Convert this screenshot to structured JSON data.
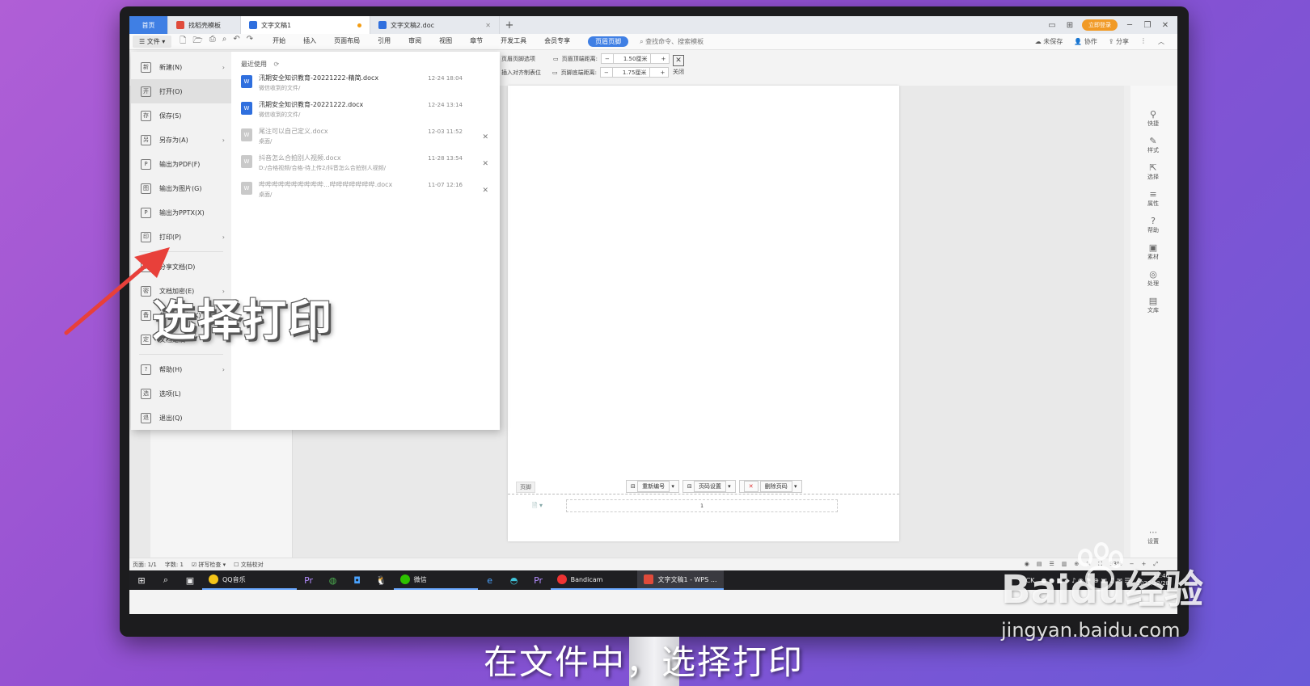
{
  "tabs": {
    "home": "首页",
    "template": "找稻壳模板",
    "doc1": "文字文稿1",
    "doc2": "文字文稿2.doc",
    "add": "+"
  },
  "titlebar": {
    "login": "立即登录"
  },
  "menu": {
    "file": "文件",
    "ribbon_tabs": [
      "开始",
      "插入",
      "页面布局",
      "引用",
      "审阅",
      "视图",
      "章节",
      "开发工具",
      "会员专享"
    ],
    "active_tab": "页眉页脚",
    "search_placeholder": "查找命令、搜索模板",
    "unsaved": "未保存",
    "collab": "协作",
    "share": "分享"
  },
  "hf_tools": {
    "options": "页眉页脚选项",
    "insert_align": "插入对齐制表位",
    "header_top_label": "页眉顶端距离:",
    "header_top_value": "1.50厘米",
    "footer_bottom_label": "页脚底端距离:",
    "footer_bottom_value": "1.75厘米",
    "minus": "−",
    "plus": "+",
    "close": "关闭"
  },
  "file_menu": {
    "items": [
      {
        "label": "新建(N)",
        "icon": "新",
        "arrow": true
      },
      {
        "label": "打开(O)",
        "icon": "开",
        "arrow": false
      },
      {
        "label": "保存(S)",
        "icon": "存",
        "arrow": false
      },
      {
        "label": "另存为(A)",
        "icon": "另",
        "arrow": true
      },
      {
        "label": "输出为PDF(F)",
        "icon": "P",
        "arrow": false
      },
      {
        "label": "输出为图片(G)",
        "icon": "图",
        "arrow": false
      },
      {
        "label": "输出为PPTX(X)",
        "icon": "P",
        "arrow": false
      },
      {
        "label": "打印(P)",
        "icon": "印",
        "arrow": true
      },
      {
        "label": "分享文档(D)",
        "icon": "享",
        "arrow": false
      },
      {
        "label": "文档加密(E)",
        "icon": "密",
        "arrow": true
      },
      {
        "label": "备份与恢复(K)",
        "icon": "备",
        "arrow": true
      },
      {
        "label": "文档定稿",
        "icon": "定",
        "arrow": false
      },
      {
        "label": "帮助(H)",
        "icon": "?",
        "arrow": true
      },
      {
        "label": "选项(L)",
        "icon": "选",
        "arrow": false
      },
      {
        "label": "退出(Q)",
        "icon": "退",
        "arrow": false
      }
    ],
    "recent_title": "最近使用",
    "recent": [
      {
        "name": "汛期安全知识教育-20221222-精简.docx",
        "path": "微信收到的文件/",
        "time": "12-24 18:04",
        "dim": false
      },
      {
        "name": "汛期安全知识教育-20221222.docx",
        "path": "微信收到的文件/",
        "time": "12-24 13:14",
        "dim": false
      },
      {
        "name": "尾注可以自己定义.docx",
        "path": "桌面/",
        "time": "12-03 11:52",
        "dim": true
      },
      {
        "name": "抖音怎么合拍别人视频.docx",
        "path": "D:/合格视频/合格-待上传2/抖音怎么合拍别人视频/",
        "time": "11-28 13:54",
        "dim": true
      },
      {
        "name": "哔哔哔哔哔哔哔哔哔哔...哔哔哔哔哔哔哔.docx",
        "path": "桌面/",
        "time": "11-07 12:16",
        "dim": true
      }
    ]
  },
  "document": {
    "footer_label": "页脚",
    "renumber": "重新编号",
    "page_setup": "页码设置",
    "delete_page": "删除页码",
    "page_number": "1"
  },
  "rightbar": {
    "items": [
      {
        "label": "快捷",
        "glyph": "⚲"
      },
      {
        "label": "样式",
        "glyph": "✎"
      },
      {
        "label": "选择",
        "glyph": "⇱"
      },
      {
        "label": "属性",
        "glyph": "≡"
      },
      {
        "label": "帮助",
        "glyph": "?"
      },
      {
        "label": "素材",
        "glyph": "▣"
      },
      {
        "label": "处理",
        "glyph": "◎"
      },
      {
        "label": "文库",
        "glyph": "▤"
      }
    ],
    "settings": "设置"
  },
  "statusbar": {
    "page": "页面: 1/1",
    "words": "字数: 1",
    "spell": "拼写检查",
    "proof": "文档校对",
    "zoom": "93%"
  },
  "taskbar": {
    "qqmusic": "QQ音乐",
    "wechat": "微信",
    "bandicam": "Bandicam",
    "wps": "文字文稿1 - WPS ...",
    "time": "11:46",
    "date": "2022/12/28",
    "ime": "CK"
  },
  "overlay": {
    "caption": "选择打印",
    "subtitle": "在文件中，选择打印",
    "watermark": "Baidu经验",
    "watermark_url": "jingyan.baidu.com"
  },
  "colors": {
    "accent": "#3f7fe4",
    "arrow": "#e8403a",
    "login": "#f19a26"
  }
}
